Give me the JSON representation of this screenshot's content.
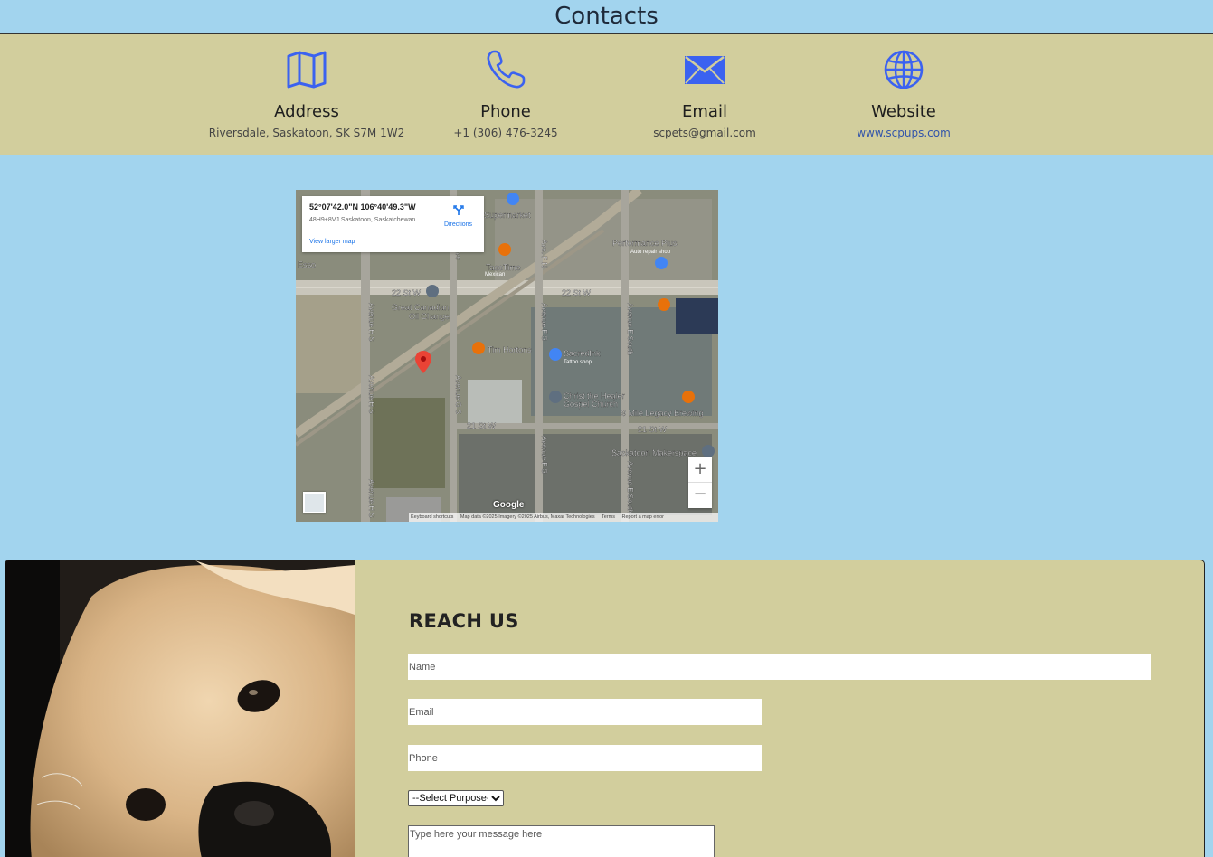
{
  "page": {
    "title": "Contacts"
  },
  "contacts": [
    {
      "icon": "map-icon",
      "heading": "Address",
      "value": "Riversdale, Saskatoon, SK S7M 1W2"
    },
    {
      "icon": "phone-icon",
      "heading": "Phone",
      "value": "+1 (306) 476-3245"
    },
    {
      "icon": "envelope-icon",
      "heading": "Email",
      "value": "scpets@gmail.com"
    },
    {
      "icon": "globe-icon",
      "heading": "Website",
      "value": "www.scpups.com"
    }
  ],
  "colors": {
    "page_bg": "#a2d4ee",
    "panel_bg": "#d2ce9d",
    "icon_blue": "#3b62f0",
    "link_blue": "#3355aa"
  },
  "map": {
    "coords": "52°07'42.0\"N 106°40'49.3\"W",
    "plus_code": "48H9+8VJ Saskatoon, Saskatchewan",
    "directions_label": "Directions",
    "larger_map_label": "View larger map",
    "zoom_in": "+",
    "zoom_out": "−",
    "logo": "Google",
    "footer": {
      "shortcuts": "Keyboard shortcuts",
      "data": "Map data ©2025 Imagery ©2025 Airbus, Maxar Technologies",
      "terms": "Terms",
      "report": "Report a map error"
    },
    "labels": {
      "supermarket": "Supermarket",
      "esso": "Esso",
      "tacotime": "TacoTime",
      "mexican": "Mexican",
      "performance": "Performance Plus",
      "auto_repair": "Auto repair shop",
      "st22_a": "22 St W",
      "st22_b": "22 St W",
      "great_canadian": "Great Canadian",
      "oil_change": "Oil Change",
      "tim_hortons": "Tim Hortons",
      "sacredink": "SacredInk",
      "tattoo": "Tattoo shop",
      "christ": "Christ the Healer",
      "gospel": "Gospel Church",
      "nine_mile": "9 Mile Legacy Brewing",
      "st21_a": "21 St W",
      "st21_b": "21 St W",
      "makerspace": "Saskatoon Makerspace",
      "ave_h": "Avenue H S",
      "ave_h2": "Avenue H S",
      "ave_h3": "Avenue H S",
      "ave_g": "Avenue G S",
      "ave_f": "Avenue F S",
      "ave_f2": "Avenue F S",
      "ave_e": "Avenue E South",
      "ave_e2": "Avenue E South",
      "ave_f_n": "Ave. F N",
      "ave_g_top": "Ave"
    }
  },
  "form": {
    "title": "REACH US",
    "name_placeholder": "Name",
    "email_placeholder": "Email",
    "phone_placeholder": "Phone",
    "purpose_selected": "--Select Purpose--",
    "message_placeholder": "Type here your message here"
  }
}
